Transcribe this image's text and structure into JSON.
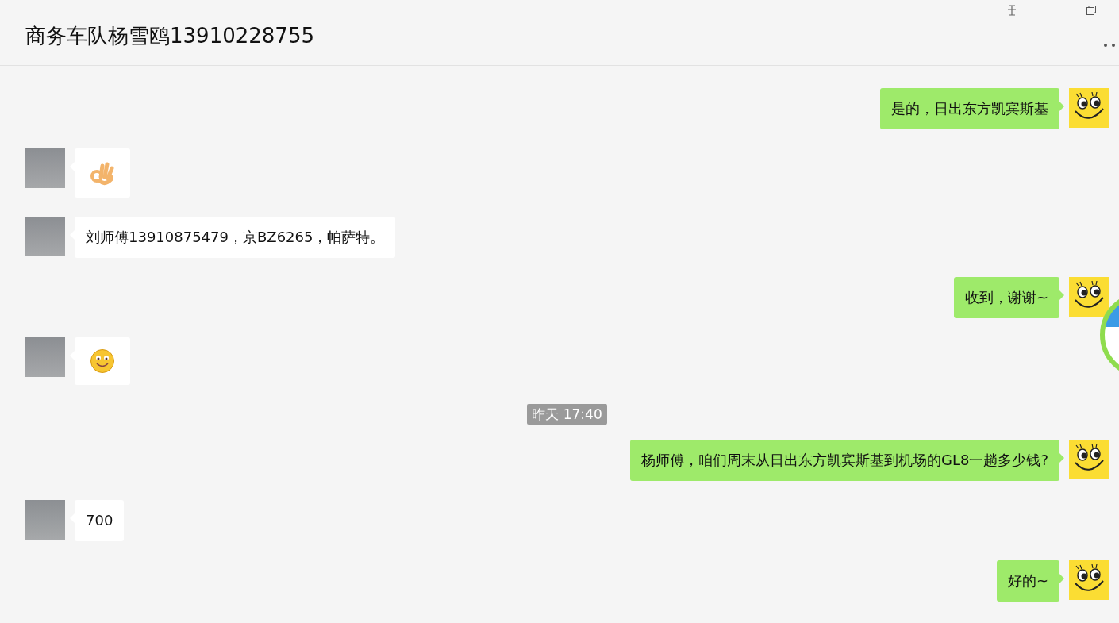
{
  "window": {
    "title": "商务车队杨雪鸥13910228755"
  },
  "messages": [
    {
      "kind": "text",
      "outgoing": true,
      "text": "是的，日出东方凯宾斯基"
    },
    {
      "kind": "okhand",
      "outgoing": false
    },
    {
      "kind": "text",
      "outgoing": false,
      "text": "刘师傅13910875479，京BZ6265，帕萨特。"
    },
    {
      "kind": "text",
      "outgoing": true,
      "text": "收到，谢谢~"
    },
    {
      "kind": "smile",
      "outgoing": false
    },
    {
      "kind": "time",
      "text": "昨天 17:40"
    },
    {
      "kind": "text",
      "outgoing": true,
      "text": "杨师傅，咱们周末从日出东方凯宾斯基到机场的GL8一趟多少钱?"
    },
    {
      "kind": "text",
      "outgoing": false,
      "text": "700"
    },
    {
      "kind": "text",
      "outgoing": true,
      "text": "好的~"
    }
  ]
}
